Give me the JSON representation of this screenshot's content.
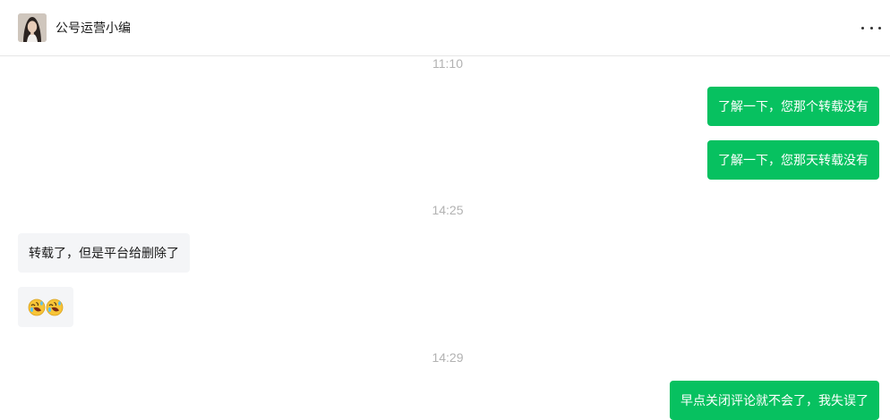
{
  "header": {
    "contact_name": "公号运营小编",
    "more_icon": "more-horizontal-icon",
    "avatar_icon": "avatar-portrait"
  },
  "messages": [
    {
      "type": "time",
      "text": "11:10"
    },
    {
      "type": "sent",
      "text": "了解一下，您那个转载没有"
    },
    {
      "type": "sent",
      "text": "了解一下，您那天转载没有"
    },
    {
      "type": "time",
      "text": "14:25"
    },
    {
      "type": "received",
      "text": "转载了，但是平台给删除了"
    },
    {
      "type": "received_emoji",
      "emojis": [
        "rolling-laughing-emoji",
        "rolling-laughing-emoji"
      ]
    },
    {
      "type": "time",
      "text": "14:29"
    },
    {
      "type": "sent",
      "text": "早点关闭评论就不会了，我失误了"
    }
  ],
  "colors": {
    "sent_bubble": "#07c160",
    "received_bubble": "#f4f5f7",
    "timestamp": "#b2b2b2"
  }
}
